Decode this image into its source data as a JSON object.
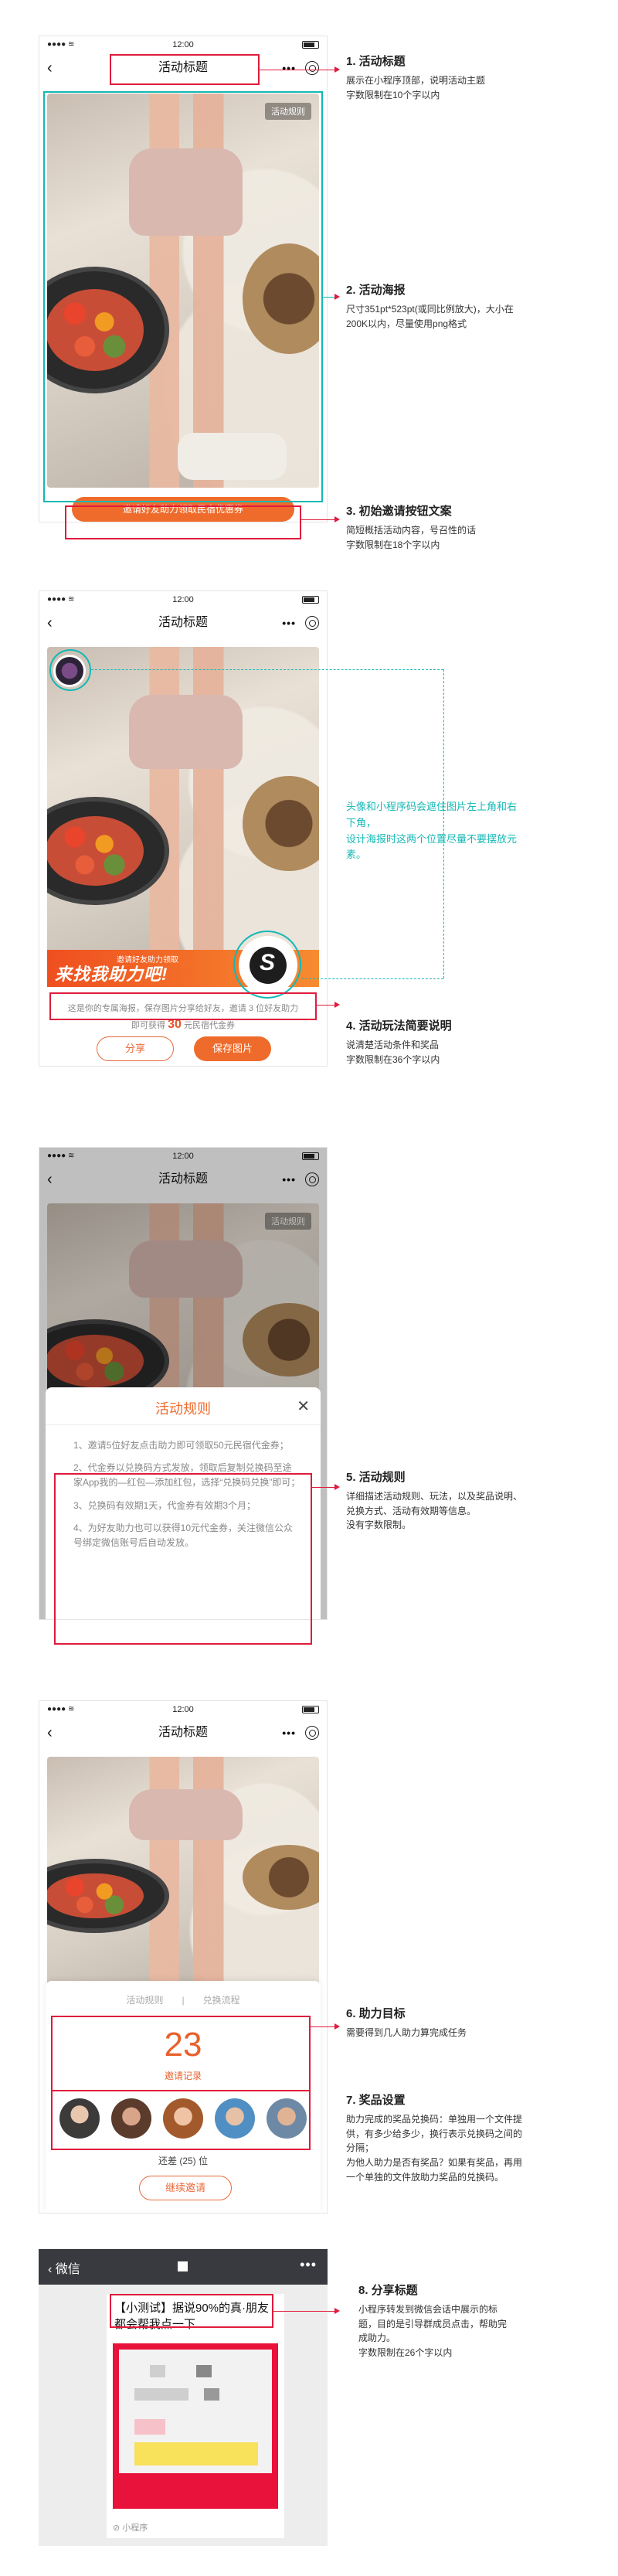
{
  "status_time": "12:00",
  "nav_title": "活动标题",
  "poster_tag": "活动规则",
  "invite_btn": "邀请好友助力领取民宿优惠券",
  "banner_small": "邀请好友助力领取",
  "banner_big": "来找我助力吧!",
  "desc_text_1": "这是你的专属海报，保存图片分享给好友，邀请 3 位好友助力",
  "desc_text_2_pre": "即可获得",
  "desc_number": "30",
  "desc_text_2_post": "元民宿代金券",
  "share_btn": "分享",
  "save_btn": "保存图片",
  "rules_title": "活动规则",
  "rules": [
    "1、邀请5位好友点击助力即可领取50元民宿代金券；",
    "2、代金券以兑换码方式发放，领取后复制兑换码至途家App我的—红包—添加红包，选择“兑换码兑换”即可；",
    "3、兑换码有效期1天，代金券有效期3个月；",
    "4、为好友助力也可以获得10元代金券，关注微信公众号绑定微信账号后自动发放。"
  ],
  "tabs": [
    "活动规则",
    "兑换流程"
  ],
  "big_number": "23",
  "invite_record": "邀请记录",
  "progress": "还差 (25) 位",
  "continue_btn": "继续邀请",
  "wx_back": "微信",
  "wx_more": "•••",
  "share_card_title": "【小测试】据说90%的真·朋友都会帮我点一下",
  "share_card_foot": "小程序",
  "annotations": [
    {
      "title": "1. 活动标题",
      "lines": [
        "展示在小程序顶部，说明活动主题",
        "字数限制在10个字以内"
      ]
    },
    {
      "title": "2. 活动海报",
      "lines": [
        "尺寸351pt*523pt(或同比例放大)，大小在",
        "200K以内，尽量使用png格式"
      ]
    },
    {
      "title": "3. 初始邀请按钮文案",
      "lines": [
        "简短概括活动内容，号召性的话",
        "字数限制在18个字以内"
      ]
    },
    {
      "title": "",
      "lines": [
        "头像和小程序码会遮住图片左上角和右",
        "下角，",
        "设计海报时这两个位置尽量不要摆放元",
        "素。"
      ]
    },
    {
      "title": "4. 活动玩法简要说明",
      "lines": [
        "说清楚活动条件和奖品",
        "字数限制在36个字以内"
      ]
    },
    {
      "title": "5. 活动规则",
      "lines": [
        "详细描述活动规则、玩法，以及奖品说明、",
        "兑换方式、活动有效期等信息。",
        "没有字数限制。"
      ]
    },
    {
      "title": "6. 助力目标",
      "lines": [
        "需要得到几人助力算完成任务"
      ]
    },
    {
      "title": "7. 奖品设置",
      "lines": [
        "助力完成的奖品兑换码：单独用一个文件提",
        "供，有多少给多少，换行表示兑换码之间的",
        "分隔；",
        "为他人助力是否有奖品？如果有奖品，再用",
        "一个单独的文件放助力奖品的兑换码。"
      ]
    },
    {
      "title": "8. 分享标题",
      "lines": [
        "小程序转发到微信会话中展示的标",
        "题，目的是引导群成员点击，帮助完",
        "成助力。",
        "字数限制在26个字以内"
      ]
    }
  ],
  "colors": {
    "accent_orange": "#ef6b2b",
    "annotation_red": "#e01b3c",
    "annotation_teal": "#14b8b5"
  }
}
